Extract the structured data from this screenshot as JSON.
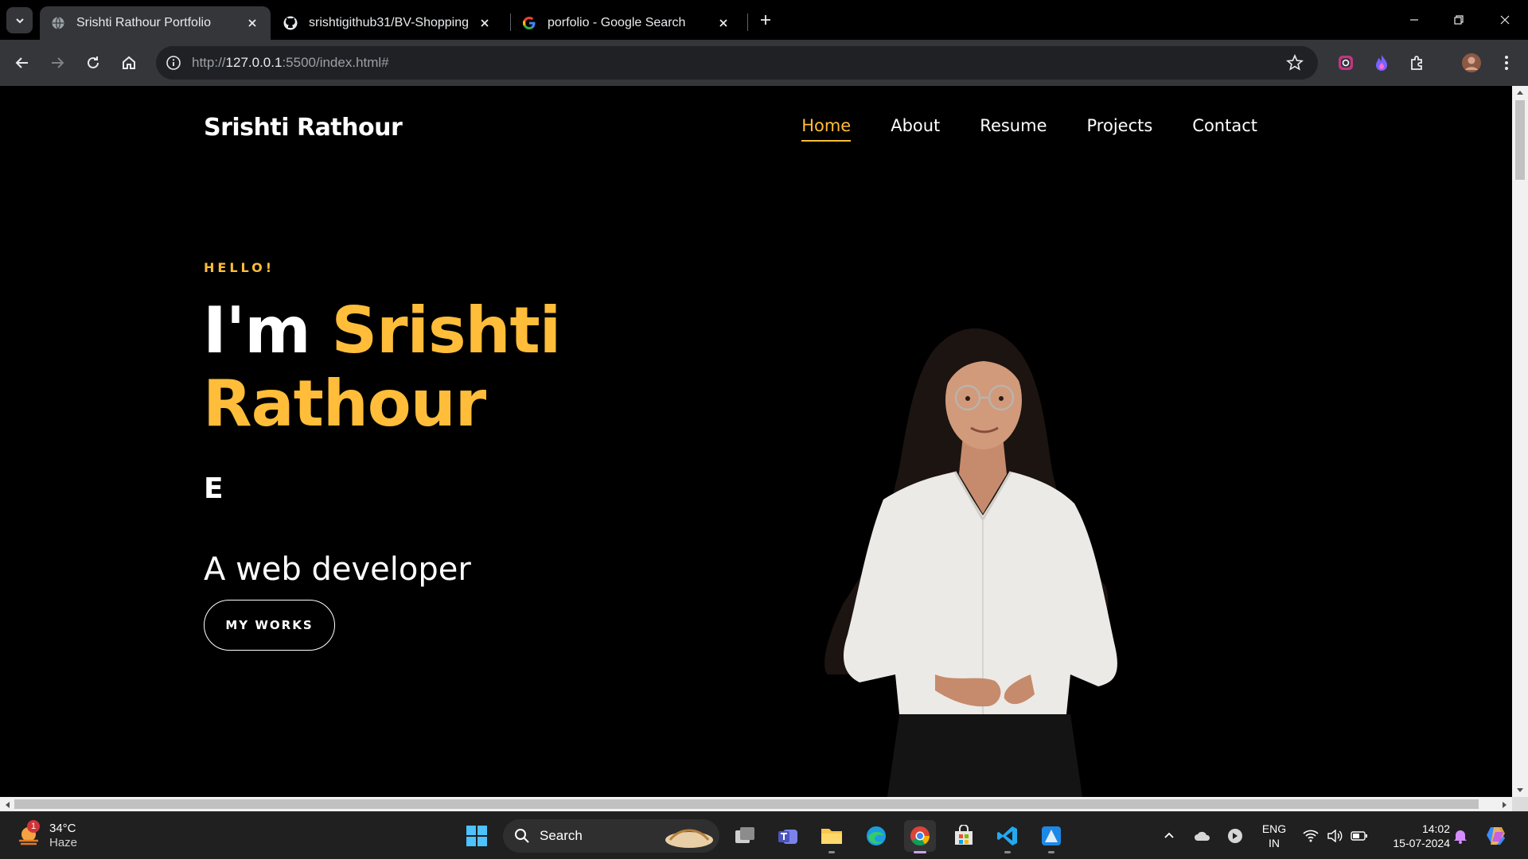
{
  "browser": {
    "tabs": [
      {
        "title": "Srishti Rathour Portfolio",
        "active": true,
        "favicon": "globe-icon"
      },
      {
        "title": "srishtigithub31/BV-Shopping",
        "active": false,
        "favicon": "github-icon"
      },
      {
        "title": "porfolio - Google Search",
        "active": false,
        "favicon": "google-icon"
      }
    ],
    "url_prefix": "http://",
    "url_host": "127.0.0.1",
    "url_rest": ":5500/index.html#"
  },
  "site": {
    "brand": "Srishti Rathour",
    "nav": [
      {
        "label": "Home",
        "active": true
      },
      {
        "label": "About",
        "active": false
      },
      {
        "label": "Resume",
        "active": false
      },
      {
        "label": "Projects",
        "active": false
      },
      {
        "label": "Contact",
        "active": false
      }
    ],
    "hero": {
      "greeting": "HELLO!",
      "im": "I'm ",
      "name_first": "Srishti",
      "name_last": "Rathour",
      "typed": "E",
      "subtitle": "A web developer",
      "cta": "MY WORKS"
    },
    "colors": {
      "accent": "#ffbd39",
      "background": "#000000",
      "text": "#ffffff"
    }
  },
  "taskbar": {
    "weather_temp": "34°C",
    "weather_desc": "Haze",
    "weather_badge": "1",
    "search_label": "Search",
    "lang_top": "ENG",
    "lang_bottom": "IN",
    "time": "14:02",
    "date": "15-07-2024"
  }
}
